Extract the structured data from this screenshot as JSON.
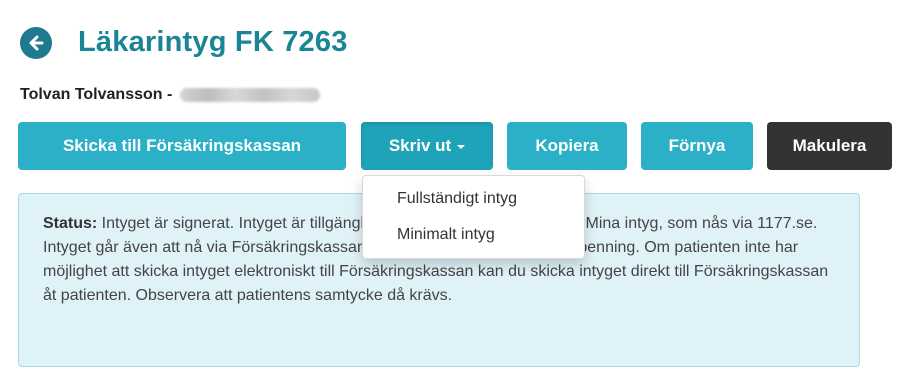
{
  "header": {
    "title": "Läkarintyg FK 7263",
    "back_icon": "arrow-left-circle-icon"
  },
  "patient": {
    "name_prefix": "Tolvan Tolvansson -"
  },
  "toolbar": {
    "send_label": "Skicka till Försäkringskassan",
    "print_label": "Skriv ut",
    "copy_label": "Kopiera",
    "renew_label": "Förnya",
    "cancel_label": "Makulera"
  },
  "print_menu": {
    "items": [
      "Fullständigt intyg",
      "Minimalt intyg"
    ]
  },
  "status": {
    "label": "Status:",
    "text": " Intyget är signerat. Intyget är tillgängligt för patienten i webbtjänsten Mina intyg, som nås via 1177.se. Intyget går även att nå via Försäkringskassans e-tjänst för ansökan om sjukpenning. Om patienten inte har möjlighet att skicka intyget elektroniskt till Försäkringskassan kan du skicka intyget direkt till Försäkringskassan åt patienten. Observera att patientens samtycke då krävs."
  },
  "colors": {
    "title": "#1a8596",
    "back_button": "#1e7a8c",
    "primary_button": "#2bb0c7",
    "dark_button": "#333333",
    "status_background": "#dff2f8",
    "status_border": "#a8d8e8"
  }
}
